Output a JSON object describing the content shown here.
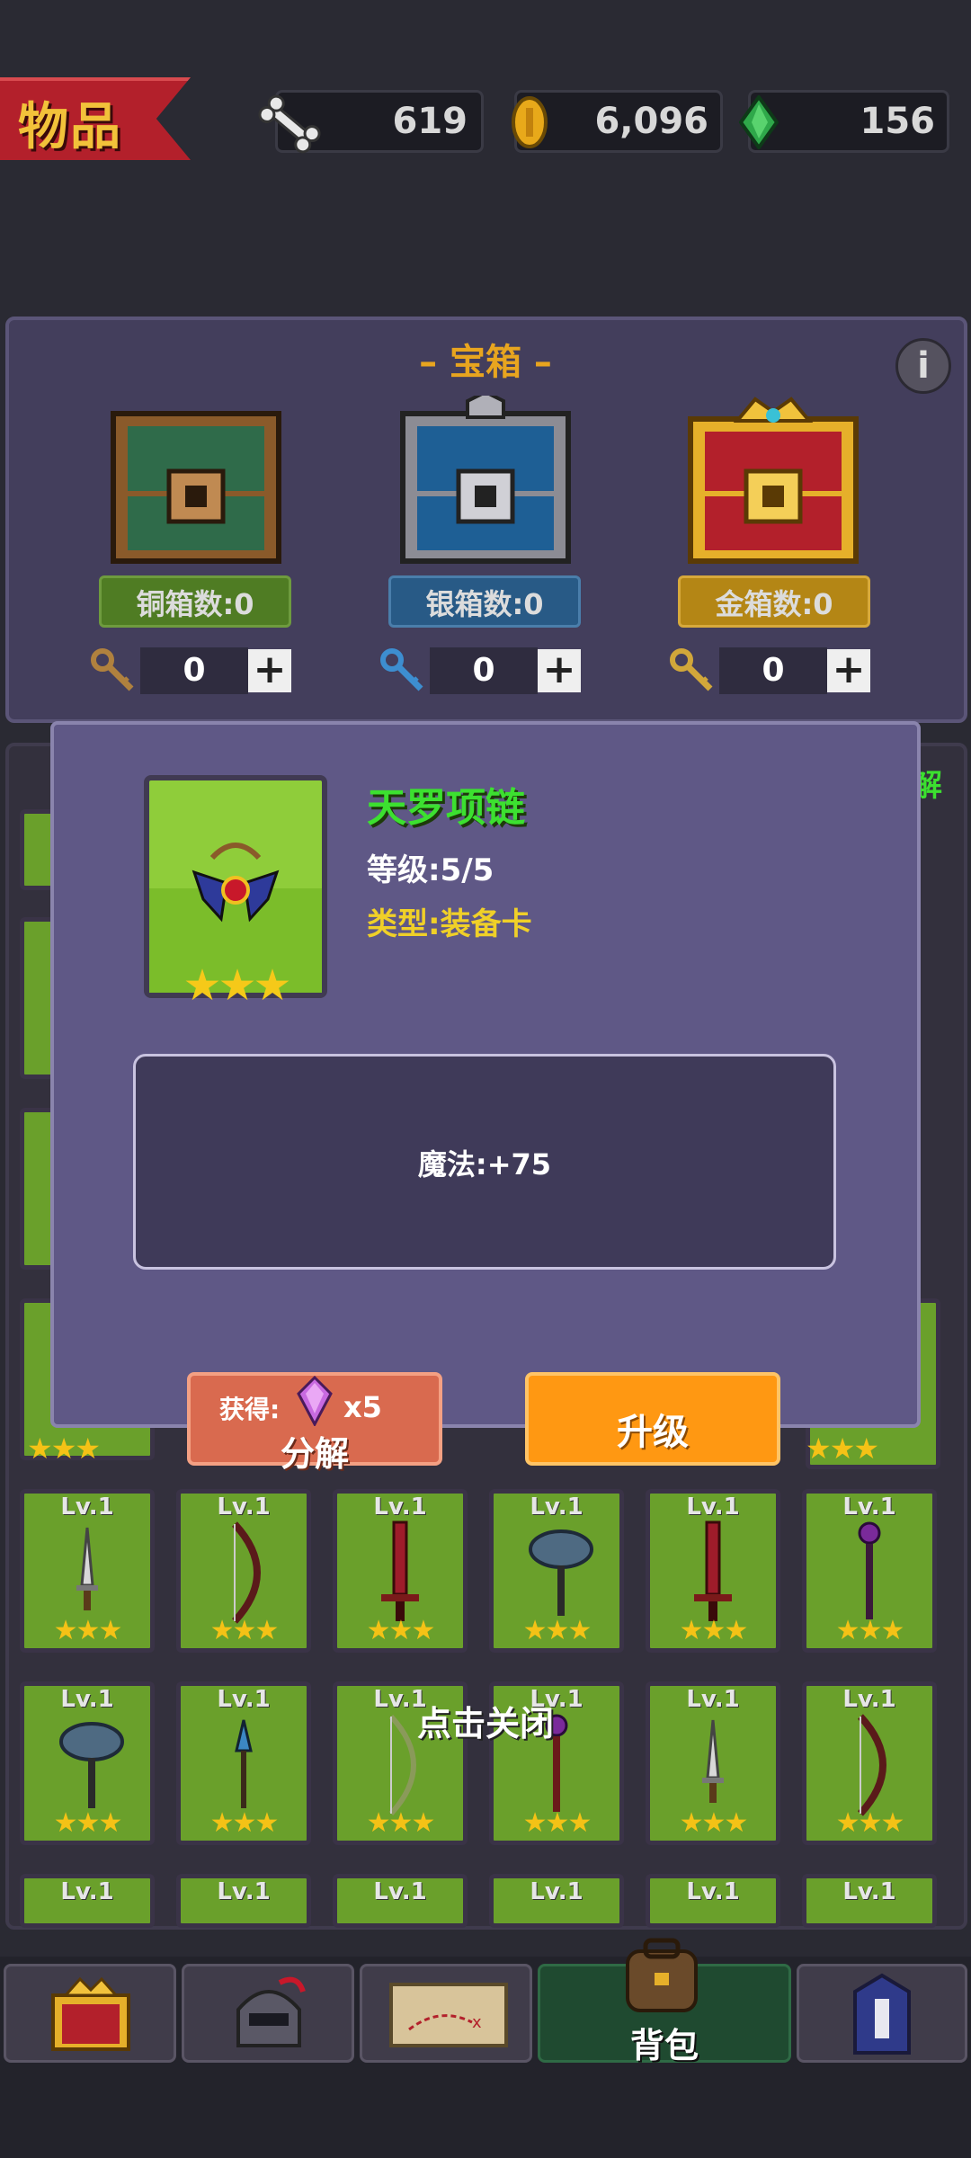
{
  "header": {
    "title": "物品",
    "resources": [
      {
        "icon": "bone-icon",
        "value": "619"
      },
      {
        "icon": "gold-coin-icon",
        "value": "6,096"
      },
      {
        "icon": "green-gem-icon",
        "value": "156"
      }
    ]
  },
  "chests": {
    "title": "宝箱",
    "items": [
      {
        "label": "铜箱数:0",
        "keys": "0",
        "color": "#4f7c23"
      },
      {
        "label": "银箱数:0",
        "keys": "0",
        "color": "#285a86"
      },
      {
        "label": "金箱数:0",
        "keys": "0",
        "color": "#b48615"
      }
    ]
  },
  "inventory": {
    "cards": [
      {
        "lv": "Lv.1",
        "icon": "dagger-icon"
      },
      {
        "lv": "Lv.1",
        "icon": "bow-icon"
      },
      {
        "lv": "Lv.1",
        "icon": "sword-icon"
      },
      {
        "lv": "Lv.1",
        "icon": "mace-icon"
      },
      {
        "lv": "Lv.1",
        "icon": "sword-icon"
      },
      {
        "lv": "Lv.1",
        "icon": "staff-icon"
      },
      {
        "lv": "Lv.1",
        "icon": "mace-icon"
      },
      {
        "lv": "Lv.1",
        "icon": "spear-icon"
      },
      {
        "lv": "Lv.1",
        "icon": "bow-icon"
      },
      {
        "lv": "Lv.1",
        "icon": "staff-icon"
      },
      {
        "lv": "Lv.1",
        "icon": "dagger-icon"
      },
      {
        "lv": "Lv.1",
        "icon": "bow-icon"
      }
    ],
    "partial_label": "解"
  },
  "modal": {
    "item_name": "天罗项链",
    "level": "等级:5/5",
    "type": "类型:装备卡",
    "stars": "★★★",
    "effect": "魔法:+75",
    "decompose": {
      "gain_label": "获得:",
      "gain_amount": "x5",
      "label": "分解"
    },
    "upgrade_label": "升级"
  },
  "close_hint": "点击关闭",
  "nav": {
    "tabs": [
      {
        "name": "chest-tab",
        "label": ""
      },
      {
        "name": "hero-tab",
        "label": ""
      },
      {
        "name": "map-tab",
        "label": ""
      },
      {
        "name": "backpack-tab",
        "label": "背包"
      },
      {
        "name": "tower-tab",
        "label": ""
      }
    ]
  }
}
